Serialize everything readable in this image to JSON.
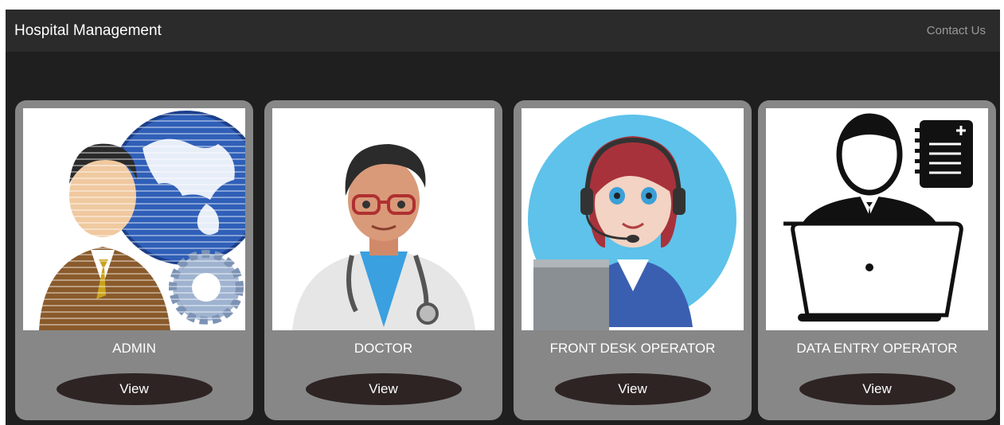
{
  "navbar": {
    "brand": "Hospital Management",
    "contact_label": "Contact Us"
  },
  "cards": [
    {
      "role": "ADMIN",
      "button": "View",
      "image_icon": "admin-globe-gear-icon"
    },
    {
      "role": "DOCTOR",
      "button": "View",
      "image_icon": "doctor-avatar-icon"
    },
    {
      "role": "FRONT DESK OPERATOR",
      "button": "View",
      "image_icon": "receptionist-headset-icon"
    },
    {
      "role": "DATA ENTRY OPERATOR",
      "button": "View",
      "image_icon": "laptop-operator-icon"
    }
  ],
  "colors": {
    "page_bg": "#1f1f1f",
    "navbar_bg": "#2b2b2b",
    "card_bg": "#878787",
    "button_bg": "#2e2424"
  }
}
